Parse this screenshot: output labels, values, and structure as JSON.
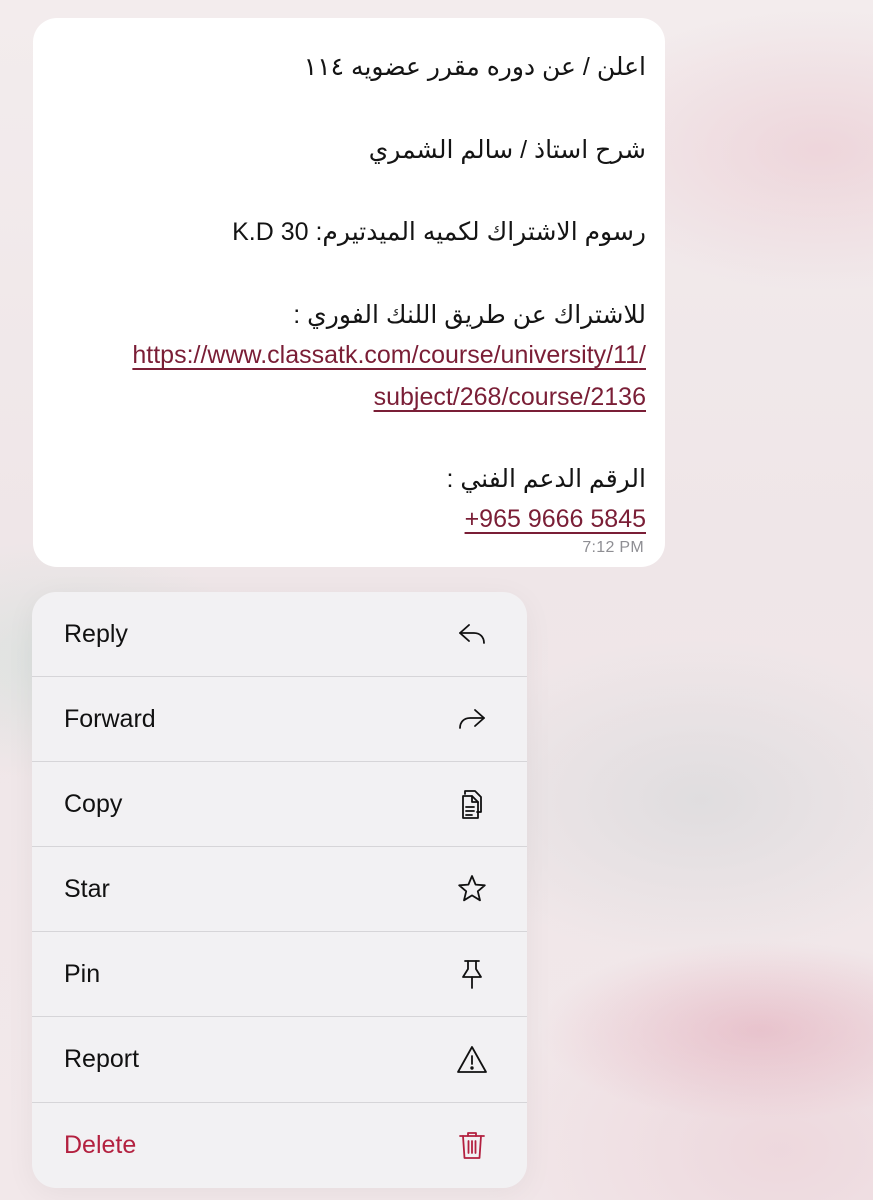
{
  "message": {
    "lines": [
      "اعلن / عن دوره مقرر عضويه ١١٤",
      "شرح استاذ / سالم الشمري",
      "رسوم الاشتراك لكميه الميدتيرم: 30 K.D",
      "للاشتراك عن طريق اللنك الفوري :",
      "الرقم الدعم الفني :"
    ],
    "link_line_1": "https://www.classatk.com/course/university/11/",
    "link_line_2": "subject/268/course/2136",
    "phone": "+965 9666 5845",
    "time": "7:12 PM"
  },
  "menu": {
    "items": [
      {
        "label": "Reply",
        "icon": "reply-icon"
      },
      {
        "label": "Forward",
        "icon": "forward-icon"
      },
      {
        "label": "Copy",
        "icon": "copy-icon"
      },
      {
        "label": "Star",
        "icon": "star-icon"
      },
      {
        "label": "Pin",
        "icon": "pin-icon"
      },
      {
        "label": "Report",
        "icon": "warning-icon"
      },
      {
        "label": "Delete",
        "icon": "trash-icon"
      }
    ]
  },
  "colors": {
    "link": "#7a1e36",
    "destructive": "#b3203f",
    "menu_bg": "#f2f1f3",
    "bubble_bg": "#ffffff"
  }
}
